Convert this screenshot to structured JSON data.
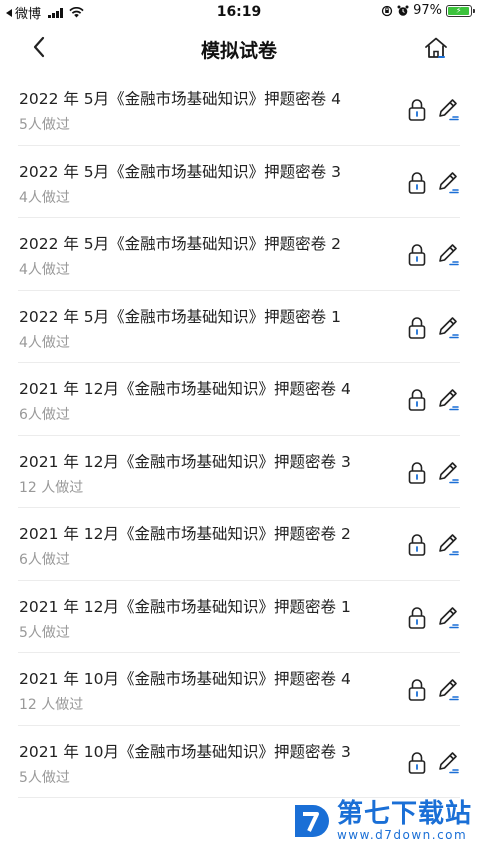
{
  "status_bar": {
    "carrier": "微博",
    "time": "16:19",
    "battery_percent": "97%",
    "battery_level": 0.97
  },
  "nav": {
    "title": "模拟试卷",
    "back_icon": "chevron-left-icon",
    "home_icon": "home-icon"
  },
  "items": [
    {
      "title": "2022 年 5月《金融市场基础知识》押题密卷 4",
      "sub": "5人做过"
    },
    {
      "title": "2022 年 5月《金融市场基础知识》押题密卷 3",
      "sub": "4人做过"
    },
    {
      "title": "2022 年 5月《金融市场基础知识》押题密卷 2",
      "sub": "4人做过"
    },
    {
      "title": "2022 年 5月《金融市场基础知识》押题密卷 1",
      "sub": "4人做过"
    },
    {
      "title": "2021 年 12月《金融市场基础知识》押题密卷 4",
      "sub": "6人做过"
    },
    {
      "title": "2021 年 12月《金融市场基础知识》押题密卷 3",
      "sub": "12 人做过"
    },
    {
      "title": "2021 年 12月《金融市场基础知识》押题密卷 2",
      "sub": "6人做过"
    },
    {
      "title": "2021 年 12月《金融市场基础知识》押题密卷 1",
      "sub": "5人做过"
    },
    {
      "title": "2021 年 10月《金融市场基础知识》押题密卷 4",
      "sub": "12 人做过"
    },
    {
      "title": "2021 年 10月《金融市场基础知识》押题密卷 3",
      "sub": "5人做过"
    }
  ],
  "watermark": {
    "main": "第七下载站",
    "sub": "www.d7down.com"
  },
  "colors": {
    "accent": "#1a6fd6",
    "text": "#222222",
    "subtext": "#999999",
    "divider": "#ececec",
    "battery": "#3cc23c"
  }
}
